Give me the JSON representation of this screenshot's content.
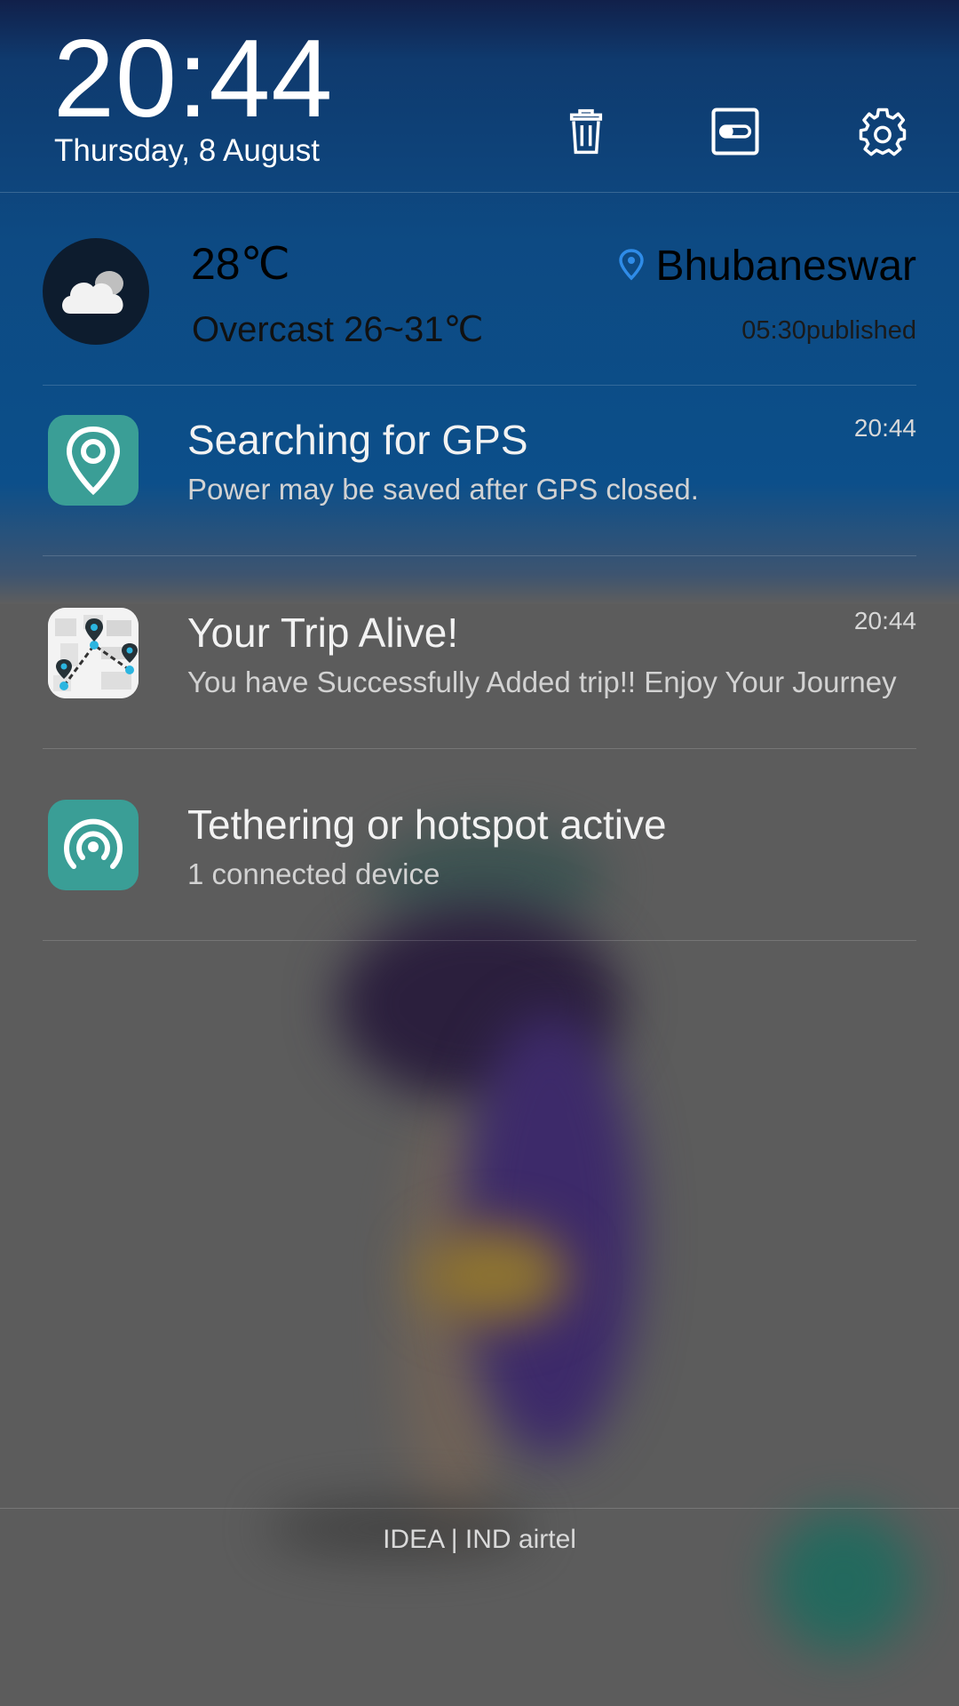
{
  "status": {
    "time": "20:44",
    "date": "Thursday, 8 August"
  },
  "header": {
    "clear_icon": "trash-icon",
    "toggle_icon": "toggle-icon",
    "settings_icon": "gear-icon"
  },
  "weather": {
    "temperature": "28℃",
    "condition": "Overcast 26~31℃",
    "location": "Bhubaneswar",
    "published": "05:30published",
    "icon": "cloud-icon"
  },
  "notifications": [
    {
      "title": "Searching for GPS",
      "body": "Power may be saved after GPS closed.",
      "time": "20:44",
      "icon": "location-pin-icon"
    },
    {
      "title": "Your Trip Alive!",
      "body": "You have Successfully Added trip!!  Enjoy Your Journey",
      "time": "20:44",
      "icon": "trip-map-icon"
    },
    {
      "title": "Tethering or hotspot active",
      "body": "1 connected device",
      "time": "",
      "icon": "hotspot-icon"
    }
  ],
  "carrier": "IDEA | IND airtel",
  "colors": {
    "accent_teal": "#3a9e96",
    "header_blue": "#0c4f8a",
    "pin_blue": "#2f8ce8"
  }
}
